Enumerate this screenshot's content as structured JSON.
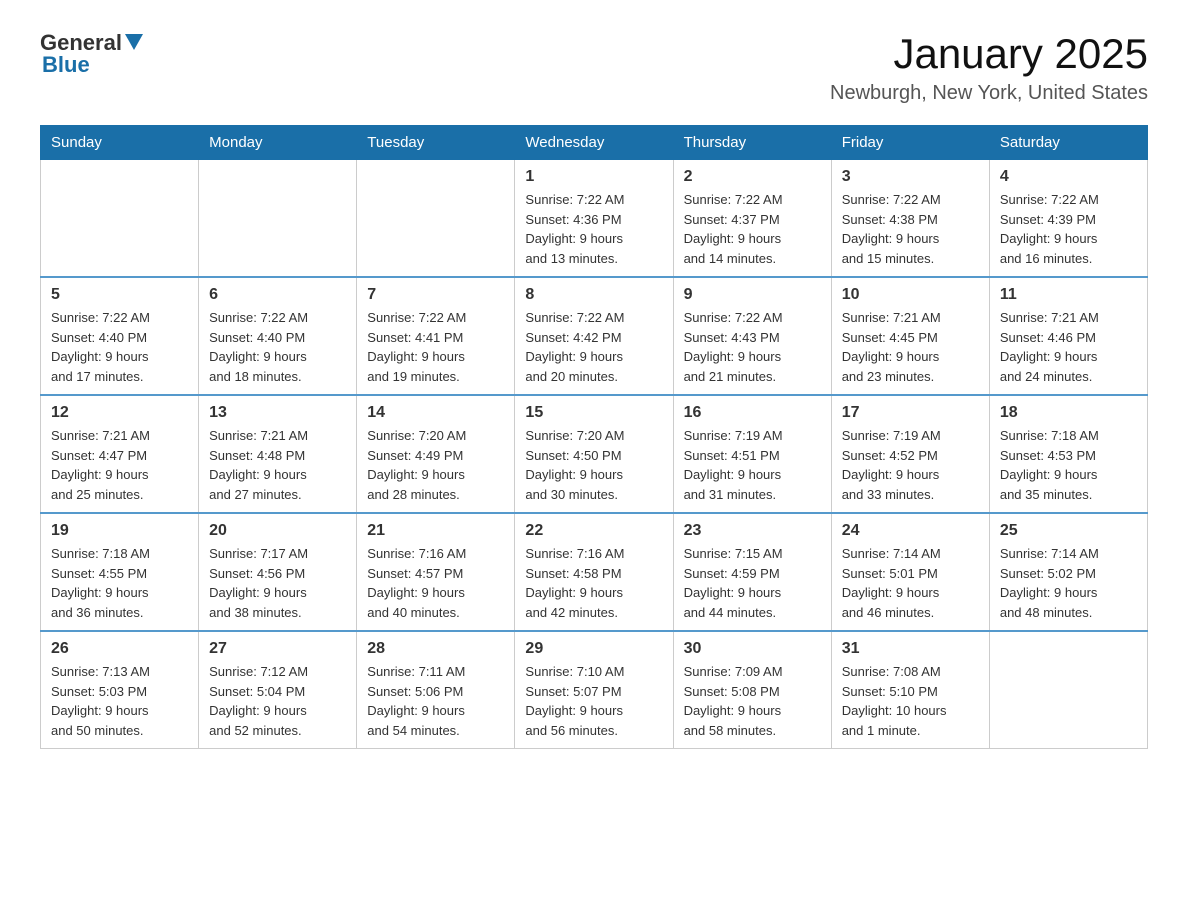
{
  "header": {
    "logo_general": "General",
    "logo_blue": "Blue",
    "title": "January 2025",
    "subtitle": "Newburgh, New York, United States"
  },
  "weekdays": [
    "Sunday",
    "Monday",
    "Tuesday",
    "Wednesday",
    "Thursday",
    "Friday",
    "Saturday"
  ],
  "weeks": [
    [
      {
        "day": "",
        "info": ""
      },
      {
        "day": "",
        "info": ""
      },
      {
        "day": "",
        "info": ""
      },
      {
        "day": "1",
        "info": "Sunrise: 7:22 AM\nSunset: 4:36 PM\nDaylight: 9 hours\nand 13 minutes."
      },
      {
        "day": "2",
        "info": "Sunrise: 7:22 AM\nSunset: 4:37 PM\nDaylight: 9 hours\nand 14 minutes."
      },
      {
        "day": "3",
        "info": "Sunrise: 7:22 AM\nSunset: 4:38 PM\nDaylight: 9 hours\nand 15 minutes."
      },
      {
        "day": "4",
        "info": "Sunrise: 7:22 AM\nSunset: 4:39 PM\nDaylight: 9 hours\nand 16 minutes."
      }
    ],
    [
      {
        "day": "5",
        "info": "Sunrise: 7:22 AM\nSunset: 4:40 PM\nDaylight: 9 hours\nand 17 minutes."
      },
      {
        "day": "6",
        "info": "Sunrise: 7:22 AM\nSunset: 4:40 PM\nDaylight: 9 hours\nand 18 minutes."
      },
      {
        "day": "7",
        "info": "Sunrise: 7:22 AM\nSunset: 4:41 PM\nDaylight: 9 hours\nand 19 minutes."
      },
      {
        "day": "8",
        "info": "Sunrise: 7:22 AM\nSunset: 4:42 PM\nDaylight: 9 hours\nand 20 minutes."
      },
      {
        "day": "9",
        "info": "Sunrise: 7:22 AM\nSunset: 4:43 PM\nDaylight: 9 hours\nand 21 minutes."
      },
      {
        "day": "10",
        "info": "Sunrise: 7:21 AM\nSunset: 4:45 PM\nDaylight: 9 hours\nand 23 minutes."
      },
      {
        "day": "11",
        "info": "Sunrise: 7:21 AM\nSunset: 4:46 PM\nDaylight: 9 hours\nand 24 minutes."
      }
    ],
    [
      {
        "day": "12",
        "info": "Sunrise: 7:21 AM\nSunset: 4:47 PM\nDaylight: 9 hours\nand 25 minutes."
      },
      {
        "day": "13",
        "info": "Sunrise: 7:21 AM\nSunset: 4:48 PM\nDaylight: 9 hours\nand 27 minutes."
      },
      {
        "day": "14",
        "info": "Sunrise: 7:20 AM\nSunset: 4:49 PM\nDaylight: 9 hours\nand 28 minutes."
      },
      {
        "day": "15",
        "info": "Sunrise: 7:20 AM\nSunset: 4:50 PM\nDaylight: 9 hours\nand 30 minutes."
      },
      {
        "day": "16",
        "info": "Sunrise: 7:19 AM\nSunset: 4:51 PM\nDaylight: 9 hours\nand 31 minutes."
      },
      {
        "day": "17",
        "info": "Sunrise: 7:19 AM\nSunset: 4:52 PM\nDaylight: 9 hours\nand 33 minutes."
      },
      {
        "day": "18",
        "info": "Sunrise: 7:18 AM\nSunset: 4:53 PM\nDaylight: 9 hours\nand 35 minutes."
      }
    ],
    [
      {
        "day": "19",
        "info": "Sunrise: 7:18 AM\nSunset: 4:55 PM\nDaylight: 9 hours\nand 36 minutes."
      },
      {
        "day": "20",
        "info": "Sunrise: 7:17 AM\nSunset: 4:56 PM\nDaylight: 9 hours\nand 38 minutes."
      },
      {
        "day": "21",
        "info": "Sunrise: 7:16 AM\nSunset: 4:57 PM\nDaylight: 9 hours\nand 40 minutes."
      },
      {
        "day": "22",
        "info": "Sunrise: 7:16 AM\nSunset: 4:58 PM\nDaylight: 9 hours\nand 42 minutes."
      },
      {
        "day": "23",
        "info": "Sunrise: 7:15 AM\nSunset: 4:59 PM\nDaylight: 9 hours\nand 44 minutes."
      },
      {
        "day": "24",
        "info": "Sunrise: 7:14 AM\nSunset: 5:01 PM\nDaylight: 9 hours\nand 46 minutes."
      },
      {
        "day": "25",
        "info": "Sunrise: 7:14 AM\nSunset: 5:02 PM\nDaylight: 9 hours\nand 48 minutes."
      }
    ],
    [
      {
        "day": "26",
        "info": "Sunrise: 7:13 AM\nSunset: 5:03 PM\nDaylight: 9 hours\nand 50 minutes."
      },
      {
        "day": "27",
        "info": "Sunrise: 7:12 AM\nSunset: 5:04 PM\nDaylight: 9 hours\nand 52 minutes."
      },
      {
        "day": "28",
        "info": "Sunrise: 7:11 AM\nSunset: 5:06 PM\nDaylight: 9 hours\nand 54 minutes."
      },
      {
        "day": "29",
        "info": "Sunrise: 7:10 AM\nSunset: 5:07 PM\nDaylight: 9 hours\nand 56 minutes."
      },
      {
        "day": "30",
        "info": "Sunrise: 7:09 AM\nSunset: 5:08 PM\nDaylight: 9 hours\nand 58 minutes."
      },
      {
        "day": "31",
        "info": "Sunrise: 7:08 AM\nSunset: 5:10 PM\nDaylight: 10 hours\nand 1 minute."
      },
      {
        "day": "",
        "info": ""
      }
    ]
  ]
}
